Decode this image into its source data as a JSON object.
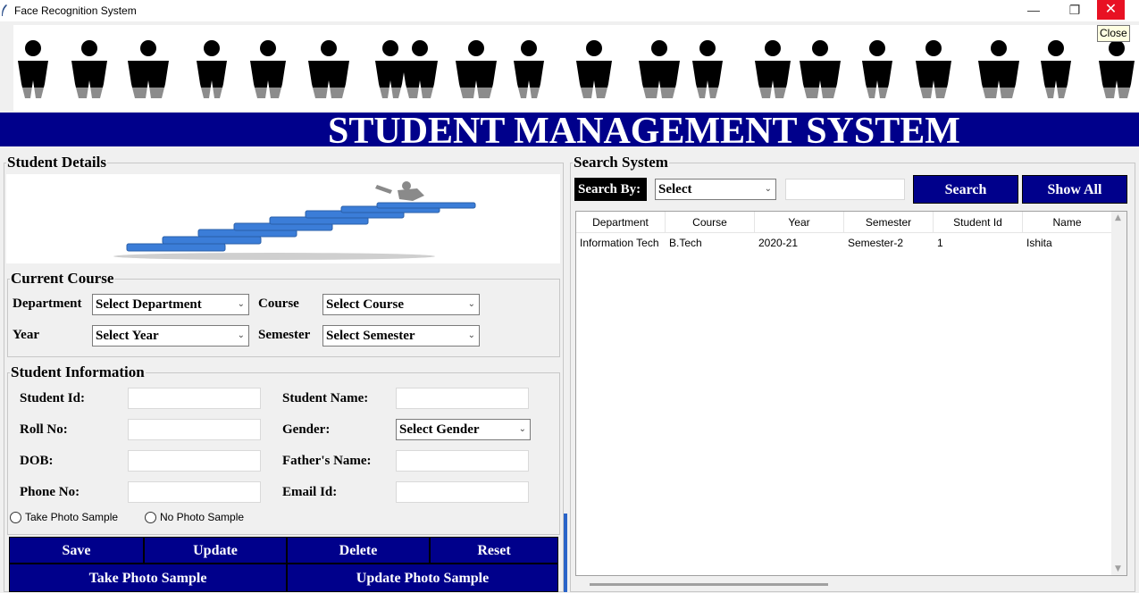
{
  "window": {
    "title": "Face Recognition System",
    "minimize_glyph": "—",
    "maximize_glyph": "❐",
    "close_glyph": "✕",
    "close_tooltip": "Close"
  },
  "header": {
    "title": "STUDENT MANAGEMENT SYSTEM"
  },
  "colors": {
    "accent": "#00008b",
    "close": "#e81123"
  },
  "left": {
    "frame_title": "Student Details",
    "current_course": {
      "title": "Current Course",
      "department_label": "Department",
      "department_value": "Select Department",
      "course_label": "Course",
      "course_value": "Select Course",
      "year_label": "Year",
      "year_value": "Select Year",
      "semester_label": "Semester",
      "semester_value": "Select Semester"
    },
    "student_info": {
      "title": "Student Information",
      "student_id_label": "Student Id:",
      "student_name_label": "Student Name:",
      "roll_no_label": "Roll No:",
      "gender_label": "Gender:",
      "gender_value": "Select Gender",
      "dob_label": "DOB:",
      "father_name_label": "Father's Name:",
      "phone_label": "Phone No:",
      "email_label": "Email Id:",
      "radio_take": "Take Photo Sample",
      "radio_no": "No Photo Sample"
    },
    "buttons": {
      "save": "Save",
      "update": "Update",
      "delete": "Delete",
      "reset": "Reset",
      "take_photo": "Take Photo Sample",
      "update_photo": "Update Photo Sample"
    }
  },
  "right": {
    "frame_title": "Search System",
    "search_by_label": "Search By:",
    "search_select_value": "Select",
    "search_input_value": "",
    "search_button": "Search",
    "show_all_button": "Show All",
    "table": {
      "columns": [
        "Department",
        "Course",
        "Year",
        "Semester",
        "Student Id",
        "Name"
      ],
      "rows": [
        [
          "Information Tech",
          "B.Tech",
          "2020-21",
          "Semester-2",
          "1",
          "Ishita"
        ]
      ]
    }
  }
}
